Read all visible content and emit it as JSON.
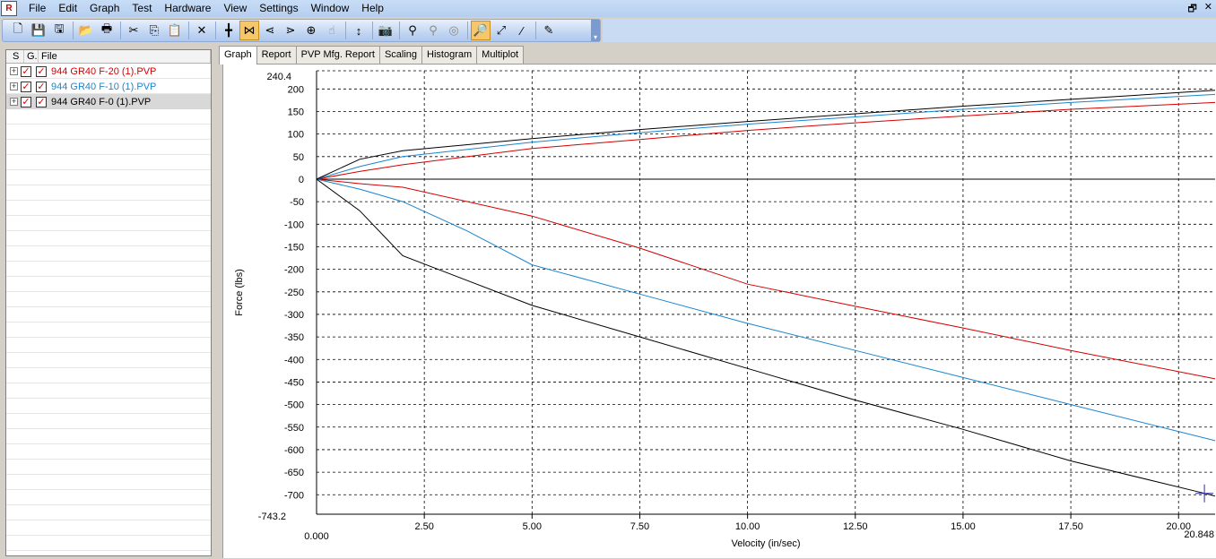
{
  "menu": {
    "app_icon": "R",
    "items": [
      "File",
      "Edit",
      "Graph",
      "Test",
      "Hardware",
      "View",
      "Settings",
      "Window",
      "Help"
    ],
    "mdi_restore": "🗗",
    "mdi_close": "✕"
  },
  "toolbar": {
    "buttons": [
      {
        "name": "new-file-icon",
        "glyph": "🗋"
      },
      {
        "name": "save-icon",
        "glyph": "💾"
      },
      {
        "name": "save-all-icon",
        "glyph": "🖫"
      },
      {
        "name": "open-folder-icon",
        "glyph": "📂"
      },
      {
        "name": "print-icon",
        "glyph": "🖶"
      },
      {
        "name": "cut-icon",
        "glyph": "✂"
      },
      {
        "name": "copy-icon",
        "glyph": "⎘"
      },
      {
        "name": "paste-icon",
        "glyph": "📋"
      },
      {
        "name": "delete-icon",
        "glyph": "✕"
      },
      {
        "name": "crosshair-icon",
        "glyph": "╋"
      },
      {
        "name": "cursor-mode-icon",
        "glyph": "⋈"
      },
      {
        "name": "left-marker-icon",
        "glyph": "⋖"
      },
      {
        "name": "right-marker-icon",
        "glyph": "⋗"
      },
      {
        "name": "target-icon",
        "glyph": "⊕"
      },
      {
        "name": "pointer-icon",
        "glyph": "☝"
      },
      {
        "name": "vertical-scale-icon",
        "glyph": "↕"
      },
      {
        "name": "camera-icon",
        "glyph": "📷"
      },
      {
        "name": "zoom-in-icon",
        "glyph": "⚲"
      },
      {
        "name": "zoom-out-icon",
        "glyph": "⚲"
      },
      {
        "name": "zoom-reset-icon",
        "glyph": "◎"
      },
      {
        "name": "zoom-tool-icon",
        "glyph": "🔎"
      },
      {
        "name": "fit-icon",
        "glyph": "⤢"
      },
      {
        "name": "divide-icon",
        "glyph": "⁄"
      },
      {
        "name": "wizard-icon",
        "glyph": "✎"
      }
    ],
    "grip": "▾"
  },
  "file_panel": {
    "columns": {
      "s": "S",
      "g": "G.",
      "file": "File"
    },
    "files": [
      {
        "name": "944 GR40 F-20 (1).PVP",
        "color": "#d40000",
        "s_checked": "✓",
        "g_checked": "✓"
      },
      {
        "name": "944 GR40 F-10 (1).PVP",
        "color": "#1a86cf",
        "s_checked": "✓",
        "g_checked": "✓"
      },
      {
        "name": "944 GR40 F-0 (1).PVP",
        "color": "#000000",
        "s_checked": "✓",
        "g_checked": "✓"
      }
    ],
    "selected_index": 2
  },
  "tabs": [
    "Graph",
    "Report",
    "PVP Mfg. Report",
    "Scaling",
    "Histogram",
    "Multiplot"
  ],
  "active_tab": 0,
  "chart_data": {
    "type": "line",
    "xlabel": "Velocity (in/sec)",
    "ylabel": "Force (lbs)",
    "xlim": [
      0,
      20.848
    ],
    "ylim": [
      -743.2,
      240.4
    ],
    "x_min_label": "0.000",
    "x_max_label": "20.848",
    "y_max_label": "240.4",
    "y_min_label": "-743.2",
    "x_ticks": [
      2.5,
      5,
      7.5,
      10,
      12.5,
      15,
      17.5,
      20
    ],
    "x_tick_labels": [
      "2.50",
      "5.00",
      "7.50",
      "10.00",
      "12.50",
      "15.00",
      "17.50",
      "20.00"
    ],
    "y_ticks": [
      200,
      150,
      100,
      50,
      0,
      -50,
      -100,
      -150,
      -200,
      -250,
      -300,
      -350,
      -400,
      -450,
      -500,
      -550,
      -600,
      -650,
      -700
    ],
    "y_tick_labels": [
      "200",
      "150",
      "100",
      "50",
      "0",
      "-50",
      "-100",
      "-150",
      "-200",
      "-250",
      "-300",
      "-350",
      "-400",
      "-450",
      "-500",
      "-550",
      "-600",
      "-650",
      "-700"
    ],
    "grid": true,
    "cursor": {
      "x": 20.6,
      "y": -697
    },
    "series": [
      {
        "name": "944 GR40 F-20 (1).PVP",
        "color": "#d40000",
        "compression": [
          [
            0,
            0
          ],
          [
            1,
            17
          ],
          [
            2,
            32
          ],
          [
            5,
            68
          ],
          [
            7.5,
            88
          ],
          [
            10,
            108
          ],
          [
            12.5,
            125
          ],
          [
            15,
            140
          ],
          [
            17.5,
            155
          ],
          [
            20.848,
            170
          ]
        ],
        "rebound": [
          [
            0,
            0
          ],
          [
            1,
            -10
          ],
          [
            2,
            -18
          ],
          [
            5,
            -82
          ],
          [
            7.5,
            -153
          ],
          [
            10,
            -233
          ],
          [
            12.5,
            -282
          ],
          [
            15,
            -330
          ],
          [
            17.5,
            -380
          ],
          [
            20.848,
            -443
          ]
        ]
      },
      {
        "name": "944 GR40 F-10 (1).PVP",
        "color": "#1a86cf",
        "compression": [
          [
            0,
            0
          ],
          [
            1,
            28
          ],
          [
            2,
            50
          ],
          [
            5,
            82
          ],
          [
            7.5,
            103
          ],
          [
            10,
            122
          ],
          [
            12.5,
            138
          ],
          [
            15,
            155
          ],
          [
            17.5,
            170
          ],
          [
            20.848,
            188
          ]
        ],
        "rebound": [
          [
            0,
            0
          ],
          [
            1,
            -22
          ],
          [
            2,
            -50
          ],
          [
            3.5,
            -115
          ],
          [
            5,
            -190
          ],
          [
            7.5,
            -255
          ],
          [
            10,
            -320
          ],
          [
            12.5,
            -380
          ],
          [
            15,
            -440
          ],
          [
            17.5,
            -500
          ],
          [
            20.848,
            -580
          ]
        ]
      },
      {
        "name": "944 GR40 F-0 (1).PVP",
        "color": "#000000",
        "compression": [
          [
            0,
            0
          ],
          [
            1,
            44
          ],
          [
            2,
            63
          ],
          [
            5,
            90
          ],
          [
            7.5,
            110
          ],
          [
            10,
            128
          ],
          [
            12.5,
            145
          ],
          [
            15,
            162
          ],
          [
            17.5,
            177
          ],
          [
            20.848,
            197
          ]
        ],
        "rebound": [
          [
            0,
            0
          ],
          [
            1,
            -70
          ],
          [
            2,
            -170
          ],
          [
            5,
            -280
          ],
          [
            7.5,
            -350
          ],
          [
            10,
            -420
          ],
          [
            12.5,
            -490
          ],
          [
            15,
            -555
          ],
          [
            17.5,
            -625
          ],
          [
            20.6,
            -697
          ],
          [
            20.848,
            -703
          ]
        ]
      }
    ]
  }
}
